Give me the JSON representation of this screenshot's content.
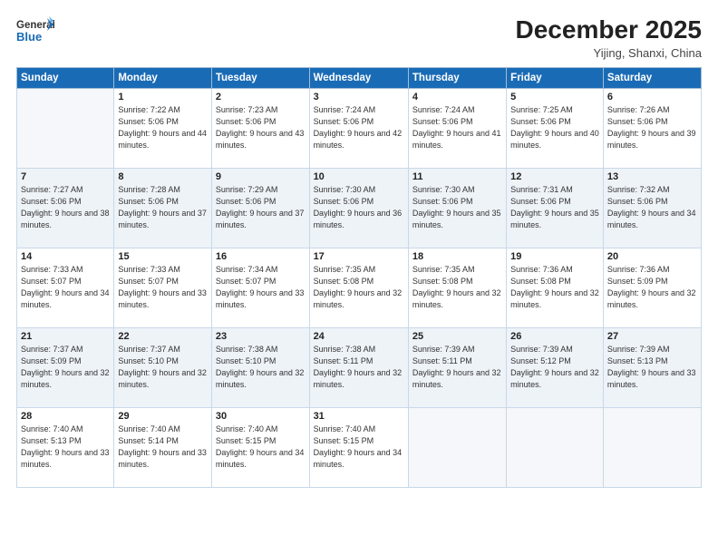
{
  "header": {
    "logo_line1": "General",
    "logo_line2": "Blue",
    "month_title": "December 2025",
    "subtitle": "Yijing, Shanxi, China"
  },
  "weekdays": [
    "Sunday",
    "Monday",
    "Tuesday",
    "Wednesday",
    "Thursday",
    "Friday",
    "Saturday"
  ],
  "weeks": [
    [
      {
        "day": "",
        "sunrise": "",
        "sunset": "",
        "daylight": ""
      },
      {
        "day": "1",
        "sunrise": "Sunrise: 7:22 AM",
        "sunset": "Sunset: 5:06 PM",
        "daylight": "Daylight: 9 hours and 44 minutes."
      },
      {
        "day": "2",
        "sunrise": "Sunrise: 7:23 AM",
        "sunset": "Sunset: 5:06 PM",
        "daylight": "Daylight: 9 hours and 43 minutes."
      },
      {
        "day": "3",
        "sunrise": "Sunrise: 7:24 AM",
        "sunset": "Sunset: 5:06 PM",
        "daylight": "Daylight: 9 hours and 42 minutes."
      },
      {
        "day": "4",
        "sunrise": "Sunrise: 7:24 AM",
        "sunset": "Sunset: 5:06 PM",
        "daylight": "Daylight: 9 hours and 41 minutes."
      },
      {
        "day": "5",
        "sunrise": "Sunrise: 7:25 AM",
        "sunset": "Sunset: 5:06 PM",
        "daylight": "Daylight: 9 hours and 40 minutes."
      },
      {
        "day": "6",
        "sunrise": "Sunrise: 7:26 AM",
        "sunset": "Sunset: 5:06 PM",
        "daylight": "Daylight: 9 hours and 39 minutes."
      }
    ],
    [
      {
        "day": "7",
        "sunrise": "Sunrise: 7:27 AM",
        "sunset": "Sunset: 5:06 PM",
        "daylight": "Daylight: 9 hours and 38 minutes."
      },
      {
        "day": "8",
        "sunrise": "Sunrise: 7:28 AM",
        "sunset": "Sunset: 5:06 PM",
        "daylight": "Daylight: 9 hours and 37 minutes."
      },
      {
        "day": "9",
        "sunrise": "Sunrise: 7:29 AM",
        "sunset": "Sunset: 5:06 PM",
        "daylight": "Daylight: 9 hours and 37 minutes."
      },
      {
        "day": "10",
        "sunrise": "Sunrise: 7:30 AM",
        "sunset": "Sunset: 5:06 PM",
        "daylight": "Daylight: 9 hours and 36 minutes."
      },
      {
        "day": "11",
        "sunrise": "Sunrise: 7:30 AM",
        "sunset": "Sunset: 5:06 PM",
        "daylight": "Daylight: 9 hours and 35 minutes."
      },
      {
        "day": "12",
        "sunrise": "Sunrise: 7:31 AM",
        "sunset": "Sunset: 5:06 PM",
        "daylight": "Daylight: 9 hours and 35 minutes."
      },
      {
        "day": "13",
        "sunrise": "Sunrise: 7:32 AM",
        "sunset": "Sunset: 5:06 PM",
        "daylight": "Daylight: 9 hours and 34 minutes."
      }
    ],
    [
      {
        "day": "14",
        "sunrise": "Sunrise: 7:33 AM",
        "sunset": "Sunset: 5:07 PM",
        "daylight": "Daylight: 9 hours and 34 minutes."
      },
      {
        "day": "15",
        "sunrise": "Sunrise: 7:33 AM",
        "sunset": "Sunset: 5:07 PM",
        "daylight": "Daylight: 9 hours and 33 minutes."
      },
      {
        "day": "16",
        "sunrise": "Sunrise: 7:34 AM",
        "sunset": "Sunset: 5:07 PM",
        "daylight": "Daylight: 9 hours and 33 minutes."
      },
      {
        "day": "17",
        "sunrise": "Sunrise: 7:35 AM",
        "sunset": "Sunset: 5:08 PM",
        "daylight": "Daylight: 9 hours and 32 minutes."
      },
      {
        "day": "18",
        "sunrise": "Sunrise: 7:35 AM",
        "sunset": "Sunset: 5:08 PM",
        "daylight": "Daylight: 9 hours and 32 minutes."
      },
      {
        "day": "19",
        "sunrise": "Sunrise: 7:36 AM",
        "sunset": "Sunset: 5:08 PM",
        "daylight": "Daylight: 9 hours and 32 minutes."
      },
      {
        "day": "20",
        "sunrise": "Sunrise: 7:36 AM",
        "sunset": "Sunset: 5:09 PM",
        "daylight": "Daylight: 9 hours and 32 minutes."
      }
    ],
    [
      {
        "day": "21",
        "sunrise": "Sunrise: 7:37 AM",
        "sunset": "Sunset: 5:09 PM",
        "daylight": "Daylight: 9 hours and 32 minutes."
      },
      {
        "day": "22",
        "sunrise": "Sunrise: 7:37 AM",
        "sunset": "Sunset: 5:10 PM",
        "daylight": "Daylight: 9 hours and 32 minutes."
      },
      {
        "day": "23",
        "sunrise": "Sunrise: 7:38 AM",
        "sunset": "Sunset: 5:10 PM",
        "daylight": "Daylight: 9 hours and 32 minutes."
      },
      {
        "day": "24",
        "sunrise": "Sunrise: 7:38 AM",
        "sunset": "Sunset: 5:11 PM",
        "daylight": "Daylight: 9 hours and 32 minutes."
      },
      {
        "day": "25",
        "sunrise": "Sunrise: 7:39 AM",
        "sunset": "Sunset: 5:11 PM",
        "daylight": "Daylight: 9 hours and 32 minutes."
      },
      {
        "day": "26",
        "sunrise": "Sunrise: 7:39 AM",
        "sunset": "Sunset: 5:12 PM",
        "daylight": "Daylight: 9 hours and 32 minutes."
      },
      {
        "day": "27",
        "sunrise": "Sunrise: 7:39 AM",
        "sunset": "Sunset: 5:13 PM",
        "daylight": "Daylight: 9 hours and 33 minutes."
      }
    ],
    [
      {
        "day": "28",
        "sunrise": "Sunrise: 7:40 AM",
        "sunset": "Sunset: 5:13 PM",
        "daylight": "Daylight: 9 hours and 33 minutes."
      },
      {
        "day": "29",
        "sunrise": "Sunrise: 7:40 AM",
        "sunset": "Sunset: 5:14 PM",
        "daylight": "Daylight: 9 hours and 33 minutes."
      },
      {
        "day": "30",
        "sunrise": "Sunrise: 7:40 AM",
        "sunset": "Sunset: 5:15 PM",
        "daylight": "Daylight: 9 hours and 34 minutes."
      },
      {
        "day": "31",
        "sunrise": "Sunrise: 7:40 AM",
        "sunset": "Sunset: 5:15 PM",
        "daylight": "Daylight: 9 hours and 34 minutes."
      },
      {
        "day": "",
        "sunrise": "",
        "sunset": "",
        "daylight": ""
      },
      {
        "day": "",
        "sunrise": "",
        "sunset": "",
        "daylight": ""
      },
      {
        "day": "",
        "sunrise": "",
        "sunset": "",
        "daylight": ""
      }
    ]
  ],
  "shaded_rows": [
    1,
    3
  ],
  "accent_color": "#1a6bb5"
}
